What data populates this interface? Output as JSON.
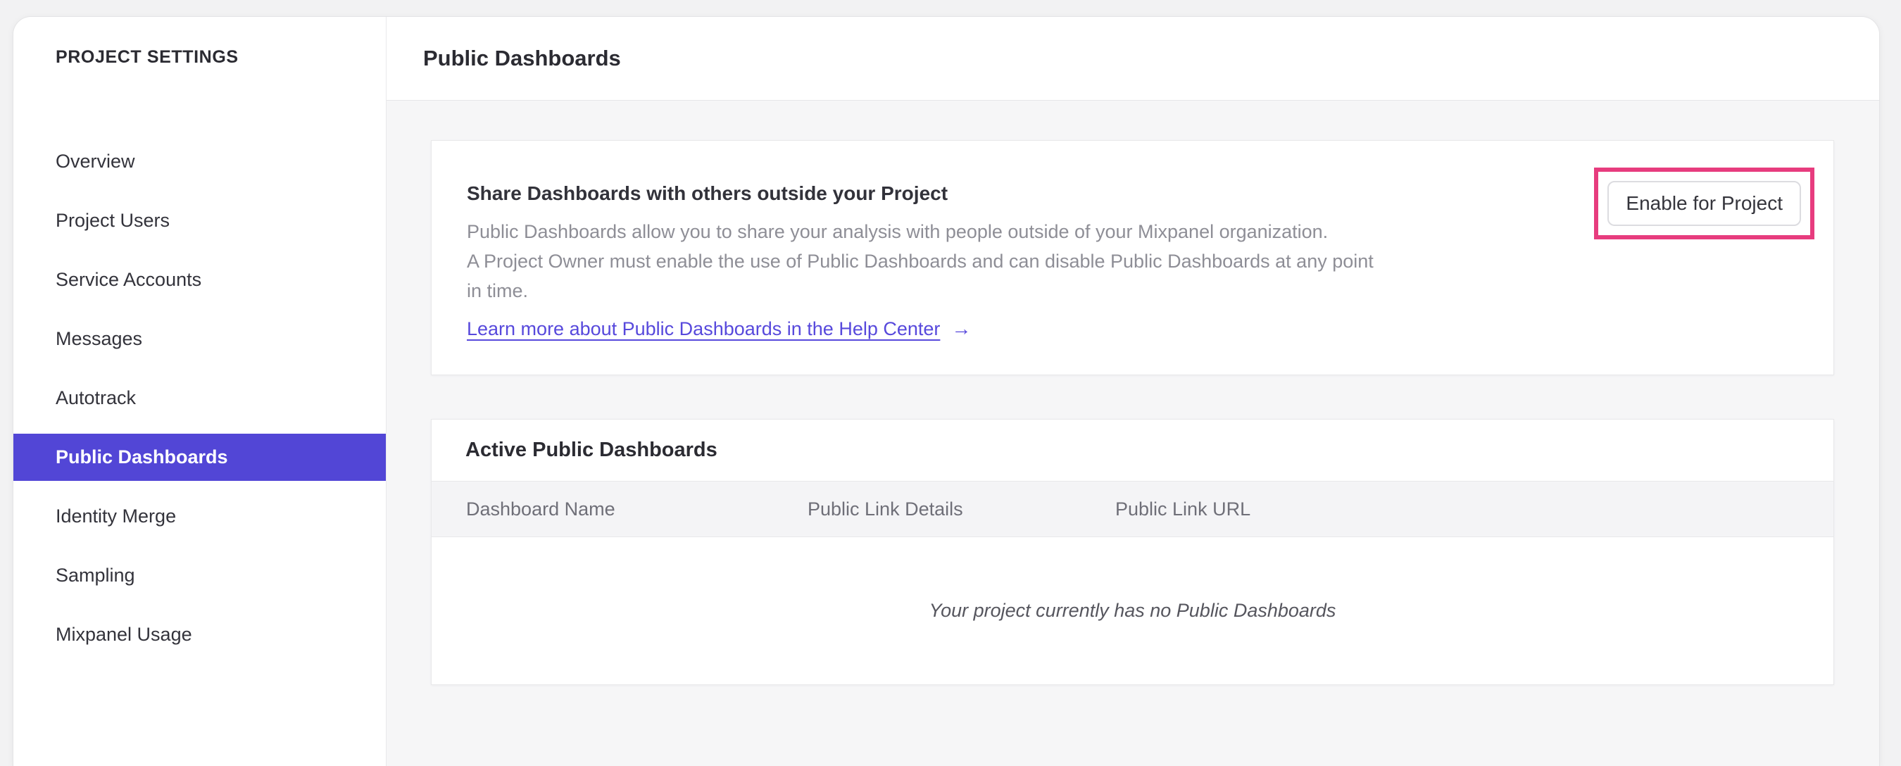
{
  "colors": {
    "accent_purple": "#5246d6",
    "link_purple": "#5749dc",
    "highlight_pink": "#e73c7e"
  },
  "sidebar": {
    "title": "PROJECT SETTINGS",
    "items": [
      {
        "label": "Overview",
        "selected": false
      },
      {
        "label": "Project Users",
        "selected": false
      },
      {
        "label": "Service Accounts",
        "selected": false
      },
      {
        "label": "Messages",
        "selected": false
      },
      {
        "label": "Autotrack",
        "selected": false
      },
      {
        "label": "Public Dashboards",
        "selected": true
      },
      {
        "label": "Identity Merge",
        "selected": false
      },
      {
        "label": "Sampling",
        "selected": false
      },
      {
        "label": "Mixpanel Usage",
        "selected": false
      }
    ]
  },
  "header": {
    "title": "Public Dashboards"
  },
  "share_card": {
    "heading": "Share Dashboards with others outside your Project",
    "body_lines": [
      "Public Dashboards allow you to share your analysis with people outside of your Mixpanel organization.",
      "A Project Owner must enable the use of Public Dashboards and can disable Public Dashboards at any point",
      "in time."
    ],
    "link_label": "Learn more about Public Dashboards in the Help Center",
    "link_arrow": "→",
    "enable_button_label": "Enable for Project"
  },
  "dashboards_card": {
    "heading": "Active Public Dashboards",
    "columns": [
      "Dashboard Name",
      "Public Link Details",
      "Public Link URL"
    ],
    "empty_text": "Your project currently has no Public Dashboards"
  }
}
